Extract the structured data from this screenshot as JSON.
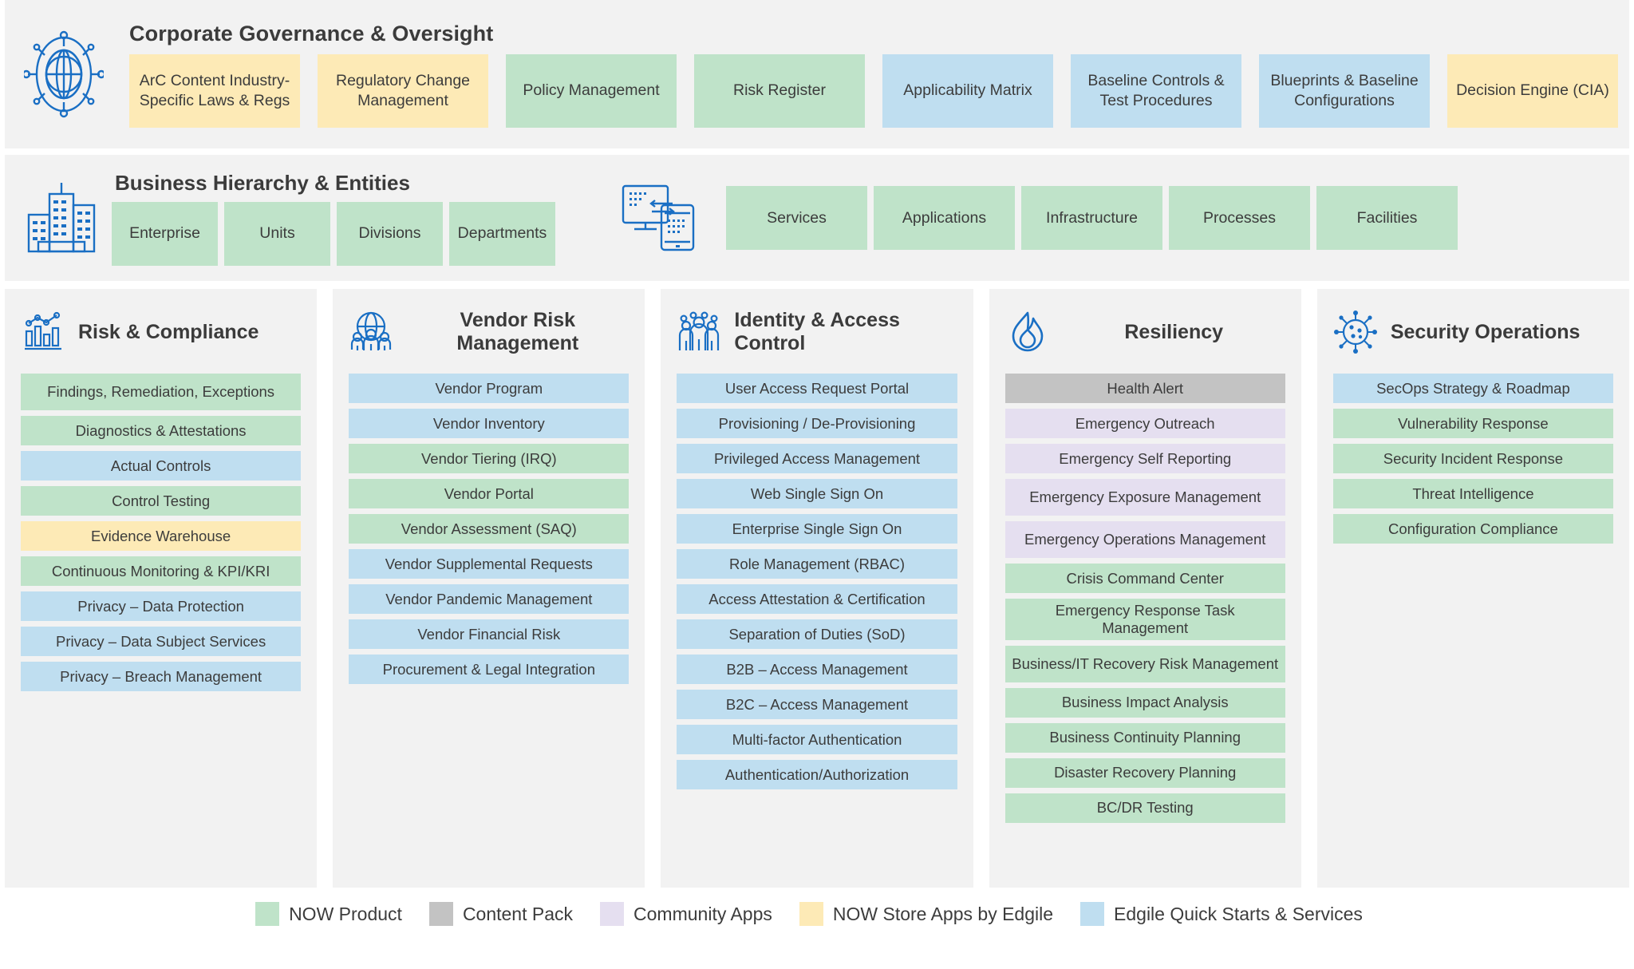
{
  "colors": {
    "green": "#bfe3c9",
    "blue": "#bfdef0",
    "yellow": "#fdeab6",
    "purple": "#e5dff0",
    "gray": "#c3c3c3",
    "band_bg": "#f2f2f2",
    "icon_blue": "#1a6fc4",
    "text": "#3c3c3c"
  },
  "governance": {
    "title": "Corporate Governance & Oversight",
    "icon": "globe-network-icon",
    "cards": [
      {
        "label": "ArC Content Industry-Specific Laws & Regs",
        "color": "yellow"
      },
      {
        "label": "Regulatory Change Management",
        "color": "yellow"
      },
      {
        "label": "Policy Management",
        "color": "green"
      },
      {
        "label": "Risk Register",
        "color": "green"
      },
      {
        "label": "Applicability Matrix",
        "color": "blue"
      },
      {
        "label": "Baseline Controls & Test Procedures",
        "color": "blue"
      },
      {
        "label": "Blueprints & Baseline Configurations",
        "color": "blue"
      },
      {
        "label": "Decision Engine (CIA)",
        "color": "yellow"
      }
    ]
  },
  "business": {
    "title": "Business Hierarchy & Entities",
    "icon": "buildings-icon",
    "tech_icon": "devices-sync-icon",
    "entities": [
      {
        "label": "Enterprise",
        "color": "green"
      },
      {
        "label": "Units",
        "color": "green"
      },
      {
        "label": "Divisions",
        "color": "green"
      },
      {
        "label": "Departments",
        "color": "green"
      }
    ],
    "assets": [
      {
        "label": "Services",
        "color": "green"
      },
      {
        "label": "Applications",
        "color": "green"
      },
      {
        "label": "Infrastructure",
        "color": "green"
      },
      {
        "label": "Processes",
        "color": "green"
      },
      {
        "label": "Facilities",
        "color": "green"
      }
    ]
  },
  "columns": [
    {
      "title": "Risk & Compliance",
      "icon": "bar-chart-icon",
      "title_align": "left",
      "items": [
        {
          "label": "Findings, Remediation, Exceptions",
          "color": "green",
          "lines": 2
        },
        {
          "label": "Diagnostics & Attestations",
          "color": "green",
          "lines": 1
        },
        {
          "label": "Actual Controls",
          "color": "blue",
          "lines": 1
        },
        {
          "label": "Control Testing",
          "color": "green",
          "lines": 1
        },
        {
          "label": "Evidence Warehouse",
          "color": "yellow",
          "lines": 1
        },
        {
          "label": "Continuous Monitoring & KPI/KRI",
          "color": "green",
          "lines": 1
        },
        {
          "label": "Privacy – Data Protection",
          "color": "blue",
          "lines": 1
        },
        {
          "label": "Privacy – Data Subject Services",
          "color": "blue",
          "lines": 1
        },
        {
          "label": "Privacy – Breach Management",
          "color": "blue",
          "lines": 1
        }
      ]
    },
    {
      "title": "Vendor Risk Management",
      "icon": "vendor-people-globe-icon",
      "title_align": "center",
      "items": [
        {
          "label": "Vendor Program",
          "color": "blue",
          "lines": 1
        },
        {
          "label": "Vendor Inventory",
          "color": "blue",
          "lines": 1
        },
        {
          "label": "Vendor Tiering (IRQ)",
          "color": "green",
          "lines": 1
        },
        {
          "label": "Vendor Portal",
          "color": "green",
          "lines": 1
        },
        {
          "label": "Vendor Assessment (SAQ)",
          "color": "green",
          "lines": 1
        },
        {
          "label": "Vendor Supplemental Requests",
          "color": "blue",
          "lines": 1
        },
        {
          "label": "Vendor Pandemic Management",
          "color": "blue",
          "lines": 1
        },
        {
          "label": "Vendor Financial Risk",
          "color": "blue",
          "lines": 1
        },
        {
          "label": "Procurement & Legal Integration",
          "color": "blue",
          "lines": 1
        }
      ]
    },
    {
      "title": "Identity & Access Control",
      "icon": "people-group-icon",
      "title_align": "left",
      "items": [
        {
          "label": "User Access Request Portal",
          "color": "blue",
          "lines": 1
        },
        {
          "label": "Provisioning / De-Provisioning",
          "color": "blue",
          "lines": 1
        },
        {
          "label": "Privileged Access Management",
          "color": "blue",
          "lines": 1
        },
        {
          "label": "Web Single Sign On",
          "color": "blue",
          "lines": 1
        },
        {
          "label": "Enterprise Single Sign On",
          "color": "blue",
          "lines": 1
        },
        {
          "label": "Role Management (RBAC)",
          "color": "blue",
          "lines": 1
        },
        {
          "label": "Access Attestation & Certification",
          "color": "blue",
          "lines": 1
        },
        {
          "label": "Separation of Duties (SoD)",
          "color": "blue",
          "lines": 1
        },
        {
          "label": "B2B – Access Management",
          "color": "blue",
          "lines": 1
        },
        {
          "label": "B2C – Access Management",
          "color": "blue",
          "lines": 1
        },
        {
          "label": "Multi-factor Authentication",
          "color": "blue",
          "lines": 1
        },
        {
          "label": "Authentication/Authorization",
          "color": "blue",
          "lines": 1
        }
      ]
    },
    {
      "title": "Resiliency",
      "icon": "flame-icon",
      "title_align": "center",
      "items": [
        {
          "label": "Health Alert",
          "color": "gray",
          "lines": 1
        },
        {
          "label": "Emergency Outreach",
          "color": "purple",
          "lines": 1
        },
        {
          "label": "Emergency Self Reporting",
          "color": "purple",
          "lines": 1
        },
        {
          "label": "Emergency Exposure Management",
          "color": "purple",
          "lines": 2
        },
        {
          "label": "Emergency Operations Management",
          "color": "purple",
          "lines": 2
        },
        {
          "label": "Crisis Command Center",
          "color": "green",
          "lines": 1
        },
        {
          "label": "Emergency Response Task Management",
          "color": "green",
          "lines": 2
        },
        {
          "label": "Business/IT Recovery Risk Management",
          "color": "green",
          "lines": 2
        },
        {
          "label": "Business Impact Analysis",
          "color": "green",
          "lines": 1
        },
        {
          "label": "Business Continuity Planning",
          "color": "green",
          "lines": 1
        },
        {
          "label": "Disaster Recovery Planning",
          "color": "green",
          "lines": 1
        },
        {
          "label": "BC/DR Testing",
          "color": "green",
          "lines": 1
        }
      ]
    },
    {
      "title": "Security Operations",
      "icon": "virus-network-icon",
      "title_align": "left",
      "items": [
        {
          "label": "SecOps Strategy & Roadmap",
          "color": "blue",
          "lines": 1
        },
        {
          "label": "Vulnerability Response",
          "color": "green",
          "lines": 1
        },
        {
          "label": "Security Incident Response",
          "color": "green",
          "lines": 1
        },
        {
          "label": "Threat Intelligence",
          "color": "green",
          "lines": 1
        },
        {
          "label": "Configuration Compliance",
          "color": "green",
          "lines": 1
        }
      ]
    }
  ],
  "legend": [
    {
      "label": "NOW Product",
      "color": "green"
    },
    {
      "label": "Content Pack",
      "color": "gray"
    },
    {
      "label": "Community Apps",
      "color": "purple"
    },
    {
      "label": "NOW Store Apps by Edgile",
      "color": "yellow"
    },
    {
      "label": "Edgile Quick Starts & Services",
      "color": "blue"
    }
  ]
}
